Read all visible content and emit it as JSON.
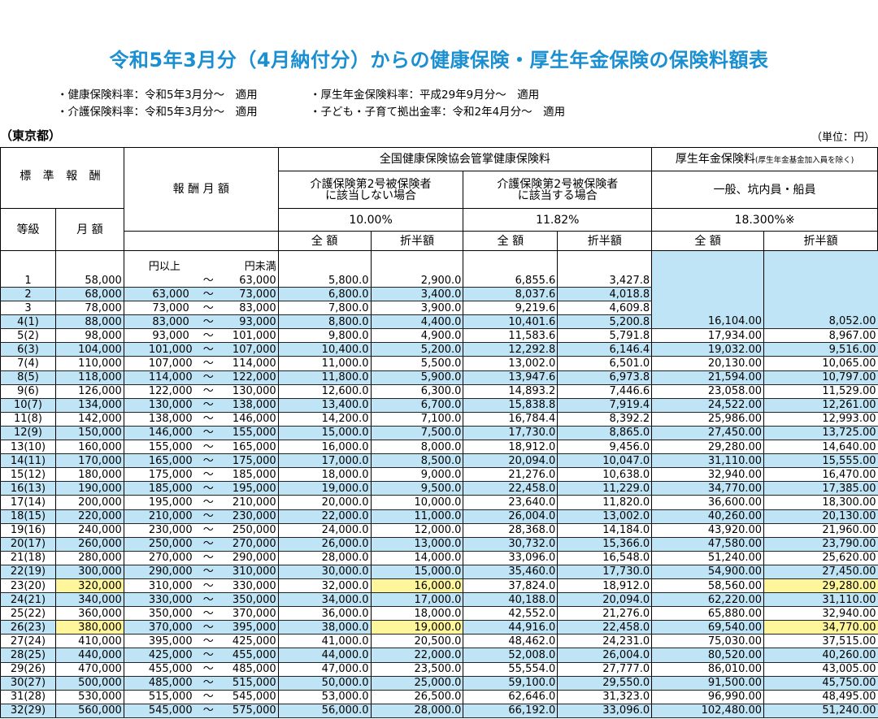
{
  "title": "令和5年3月分（4月納付分）からの健康保険・厚生年金保険の保険料額表",
  "notes": [
    "・健康保険料率：令和5年3月分～　適用",
    "・厚生年金保険料率：平成29年9月分～　適用",
    "・介護保険料率：令和5年3月分～　適用",
    "・子ども・子育て拠出金率：令和2年4月分～　適用"
  ],
  "prefecture": "（東京都）",
  "unit": "（単位：円）",
  "header": {
    "std_remuneration": "標 準 報 酬",
    "remuneration_monthly": "報 酬 月 額",
    "kyokai": "全国健康保険協会管掌健康保険料",
    "kosei": "厚生年金保険料",
    "kosei_note": "(厚生年金基金加入員を除く)",
    "no_care_line1": "介護保険第2号被保険者",
    "no_care_line2": "に該当しない場合",
    "care_line1": "介護保険第2号被保険者",
    "care_line2": "に該当する場合",
    "general": "一般、坑内員・船員",
    "rate1": "10.00%",
    "rate2": "11.82%",
    "rate3": "18.300%※",
    "grade": "等級",
    "monthly": "月 額",
    "full": "全 額",
    "half": "折半額",
    "yen_over": "円以上",
    "yen_under": "円未満",
    "tilde": "～"
  },
  "rows": [
    {
      "grade": "1",
      "monthly": "58,000",
      "from": "",
      "to": "63,000",
      "h_full": "5,800.0",
      "h_half": "2,900.0",
      "c_full": "6,855.6",
      "c_half": "3,427.8",
      "p_full": "",
      "p_half": ""
    },
    {
      "grade": "2",
      "monthly": "68,000",
      "from": "63,000",
      "to": "73,000",
      "h_full": "6,800.0",
      "h_half": "3,400.0",
      "c_full": "8,037.6",
      "c_half": "4,018.8",
      "p_full": "",
      "p_half": ""
    },
    {
      "grade": "3",
      "monthly": "78,000",
      "from": "73,000",
      "to": "83,000",
      "h_full": "7,800.0",
      "h_half": "3,900.0",
      "c_full": "9,219.6",
      "c_half": "4,609.8",
      "p_full": "",
      "p_half": ""
    },
    {
      "grade": "4(1)",
      "monthly": "88,000",
      "from": "83,000",
      "to": "93,000",
      "h_full": "8,800.0",
      "h_half": "4,400.0",
      "c_full": "10,401.6",
      "c_half": "5,200.8",
      "p_full": "16,104.00",
      "p_half": "8,052.00"
    },
    {
      "grade": "5(2)",
      "monthly": "98,000",
      "from": "93,000",
      "to": "101,000",
      "h_full": "9,800.0",
      "h_half": "4,900.0",
      "c_full": "11,583.6",
      "c_half": "5,791.8",
      "p_full": "17,934.00",
      "p_half": "8,967.00"
    },
    {
      "grade": "6(3)",
      "monthly": "104,000",
      "from": "101,000",
      "to": "107,000",
      "h_full": "10,400.0",
      "h_half": "5,200.0",
      "c_full": "12,292.8",
      "c_half": "6,146.4",
      "p_full": "19,032.00",
      "p_half": "9,516.00"
    },
    {
      "grade": "7(4)",
      "monthly": "110,000",
      "from": "107,000",
      "to": "114,000",
      "h_full": "11,000.0",
      "h_half": "5,500.0",
      "c_full": "13,002.0",
      "c_half": "6,501.0",
      "p_full": "20,130.00",
      "p_half": "10,065.00"
    },
    {
      "grade": "8(5)",
      "monthly": "118,000",
      "from": "114,000",
      "to": "122,000",
      "h_full": "11,800.0",
      "h_half": "5,900.0",
      "c_full": "13,947.6",
      "c_half": "6,973.8",
      "p_full": "21,594.00",
      "p_half": "10,797.00"
    },
    {
      "grade": "9(6)",
      "monthly": "126,000",
      "from": "122,000",
      "to": "130,000",
      "h_full": "12,600.0",
      "h_half": "6,300.0",
      "c_full": "14,893.2",
      "c_half": "7,446.6",
      "p_full": "23,058.00",
      "p_half": "11,529.00"
    },
    {
      "grade": "10(7)",
      "monthly": "134,000",
      "from": "130,000",
      "to": "138,000",
      "h_full": "13,400.0",
      "h_half": "6,700.0",
      "c_full": "15,838.8",
      "c_half": "7,919.4",
      "p_full": "24,522.00",
      "p_half": "12,261.00"
    },
    {
      "grade": "11(8)",
      "monthly": "142,000",
      "from": "138,000",
      "to": "146,000",
      "h_full": "14,200.0",
      "h_half": "7,100.0",
      "c_full": "16,784.4",
      "c_half": "8,392.2",
      "p_full": "25,986.00",
      "p_half": "12,993.00"
    },
    {
      "grade": "12(9)",
      "monthly": "150,000",
      "from": "146,000",
      "to": "155,000",
      "h_full": "15,000.0",
      "h_half": "7,500.0",
      "c_full": "17,730.0",
      "c_half": "8,865.0",
      "p_full": "27,450.00",
      "p_half": "13,725.00"
    },
    {
      "grade": "13(10)",
      "monthly": "160,000",
      "from": "155,000",
      "to": "165,000",
      "h_full": "16,000.0",
      "h_half": "8,000.0",
      "c_full": "18,912.0",
      "c_half": "9,456.0",
      "p_full": "29,280.00",
      "p_half": "14,640.00"
    },
    {
      "grade": "14(11)",
      "monthly": "170,000",
      "from": "165,000",
      "to": "175,000",
      "h_full": "17,000.0",
      "h_half": "8,500.0",
      "c_full": "20,094.0",
      "c_half": "10,047.0",
      "p_full": "31,110.00",
      "p_half": "15,555.00"
    },
    {
      "grade": "15(12)",
      "monthly": "180,000",
      "from": "175,000",
      "to": "185,000",
      "h_full": "18,000.0",
      "h_half": "9,000.0",
      "c_full": "21,276.0",
      "c_half": "10,638.0",
      "p_full": "32,940.00",
      "p_half": "16,470.00"
    },
    {
      "grade": "16(13)",
      "monthly": "190,000",
      "from": "185,000",
      "to": "195,000",
      "h_full": "19,000.0",
      "h_half": "9,500.0",
      "c_full": "22,458.0",
      "c_half": "11,229.0",
      "p_full": "34,770.00",
      "p_half": "17,385.00"
    },
    {
      "grade": "17(14)",
      "monthly": "200,000",
      "from": "195,000",
      "to": "210,000",
      "h_full": "20,000.0",
      "h_half": "10,000.0",
      "c_full": "23,640.0",
      "c_half": "11,820.0",
      "p_full": "36,600.00",
      "p_half": "18,300.00"
    },
    {
      "grade": "18(15)",
      "monthly": "220,000",
      "from": "210,000",
      "to": "230,000",
      "h_full": "22,000.0",
      "h_half": "11,000.0",
      "c_full": "26,004.0",
      "c_half": "13,002.0",
      "p_full": "40,260.00",
      "p_half": "20,130.00"
    },
    {
      "grade": "19(16)",
      "monthly": "240,000",
      "from": "230,000",
      "to": "250,000",
      "h_full": "24,000.0",
      "h_half": "12,000.0",
      "c_full": "28,368.0",
      "c_half": "14,184.0",
      "p_full": "43,920.00",
      "p_half": "21,960.00"
    },
    {
      "grade": "20(17)",
      "monthly": "260,000",
      "from": "250,000",
      "to": "270,000",
      "h_full": "26,000.0",
      "h_half": "13,000.0",
      "c_full": "30,732.0",
      "c_half": "15,366.0",
      "p_full": "47,580.00",
      "p_half": "23,790.00"
    },
    {
      "grade": "21(18)",
      "monthly": "280,000",
      "from": "270,000",
      "to": "290,000",
      "h_full": "28,000.0",
      "h_half": "14,000.0",
      "c_full": "33,096.0",
      "c_half": "16,548.0",
      "p_full": "51,240.00",
      "p_half": "25,620.00"
    },
    {
      "grade": "22(19)",
      "monthly": "300,000",
      "from": "290,000",
      "to": "310,000",
      "h_full": "30,000.0",
      "h_half": "15,000.0",
      "c_full": "35,460.0",
      "c_half": "17,730.0",
      "p_full": "54,900.00",
      "p_half": "27,450.00"
    },
    {
      "grade": "23(20)",
      "monthly": "320,000",
      "from": "310,000",
      "to": "330,000",
      "h_full": "32,000.0",
      "h_half": "16,000.0",
      "c_full": "37,824.0",
      "c_half": "18,912.0",
      "p_full": "58,560.00",
      "p_half": "29,280.00",
      "hl": true
    },
    {
      "grade": "24(21)",
      "monthly": "340,000",
      "from": "330,000",
      "to": "350,000",
      "h_full": "34,000.0",
      "h_half": "17,000.0",
      "c_full": "40,188.0",
      "c_half": "20,094.0",
      "p_full": "62,220.00",
      "p_half": "31,110.00"
    },
    {
      "grade": "25(22)",
      "monthly": "360,000",
      "from": "350,000",
      "to": "370,000",
      "h_full": "36,000.0",
      "h_half": "18,000.0",
      "c_full": "42,552.0",
      "c_half": "21,276.0",
      "p_full": "65,880.00",
      "p_half": "32,940.00"
    },
    {
      "grade": "26(23)",
      "monthly": "380,000",
      "from": "370,000",
      "to": "395,000",
      "h_full": "38,000.0",
      "h_half": "19,000.0",
      "c_full": "44,916.0",
      "c_half": "22,458.0",
      "p_full": "69,540.00",
      "p_half": "34,770.00",
      "hl": true
    },
    {
      "grade": "27(24)",
      "monthly": "410,000",
      "from": "395,000",
      "to": "425,000",
      "h_full": "41,000.0",
      "h_half": "20,500.0",
      "c_full": "48,462.0",
      "c_half": "24,231.0",
      "p_full": "75,030.00",
      "p_half": "37,515.00"
    },
    {
      "grade": "28(25)",
      "monthly": "440,000",
      "from": "425,000",
      "to": "455,000",
      "h_full": "44,000.0",
      "h_half": "22,000.0",
      "c_full": "52,008.0",
      "c_half": "26,004.0",
      "p_full": "80,520.00",
      "p_half": "40,260.00"
    },
    {
      "grade": "29(26)",
      "monthly": "470,000",
      "from": "455,000",
      "to": "485,000",
      "h_full": "47,000.0",
      "h_half": "23,500.0",
      "c_full": "55,554.0",
      "c_half": "27,777.0",
      "p_full": "86,010.00",
      "p_half": "43,005.00"
    },
    {
      "grade": "30(27)",
      "monthly": "500,000",
      "from": "485,000",
      "to": "515,000",
      "h_full": "50,000.0",
      "h_half": "25,000.0",
      "c_full": "59,100.0",
      "c_half": "29,550.0",
      "p_full": "91,500.00",
      "p_half": "45,750.00"
    },
    {
      "grade": "31(28)",
      "monthly": "530,000",
      "from": "515,000",
      "to": "545,000",
      "h_full": "53,000.0",
      "h_half": "26,500.0",
      "c_full": "62,646.0",
      "c_half": "31,323.0",
      "p_full": "96,990.00",
      "p_half": "48,495.00"
    },
    {
      "grade": "32(29)",
      "monthly": "560,000",
      "from": "545,000",
      "to": "575,000",
      "h_full": "56,000.0",
      "h_half": "28,000.0",
      "c_full": "66,192.0",
      "c_half": "33,096.0",
      "p_full": "102,480.00",
      "p_half": "51,240.00"
    }
  ]
}
